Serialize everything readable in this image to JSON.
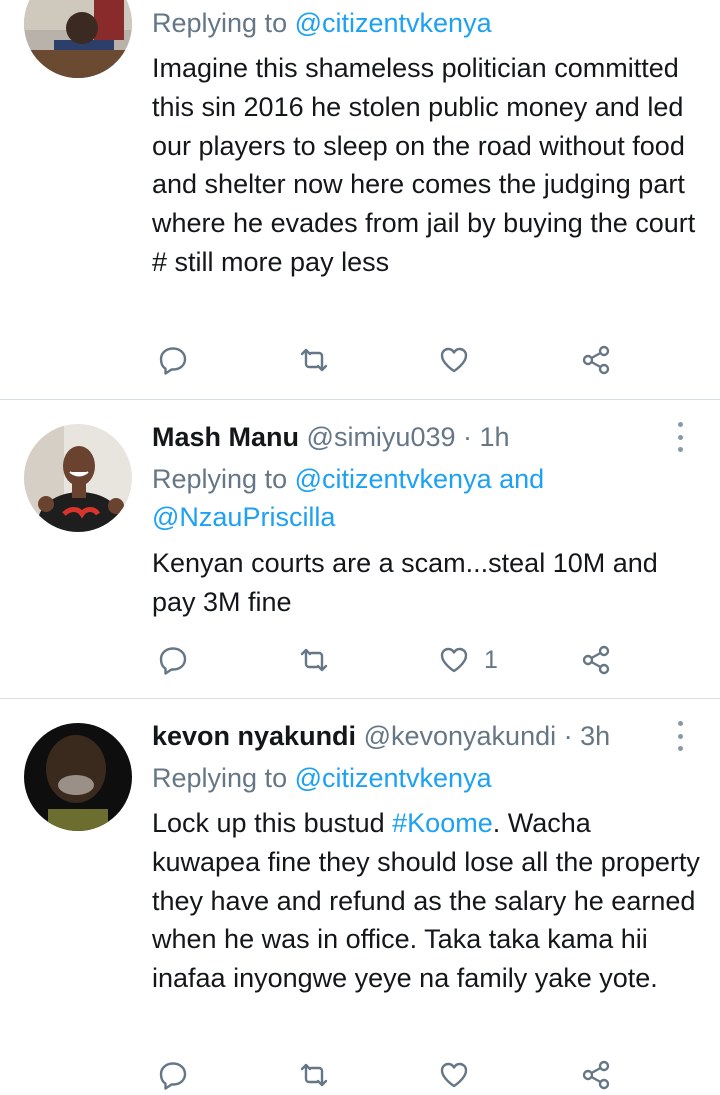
{
  "colors": {
    "link": "#1da1f2",
    "muted": "#657786",
    "text": "#14171a",
    "icon": "#657786"
  },
  "tweets": [
    {
      "name": "",
      "handle": "",
      "time": "",
      "reply_prefix": "Replying to ",
      "reply_mentions": [
        "@citizentvkenya"
      ],
      "body": "Imagine this shameless politician committed this sin 2016 he stolen public money and led our players to sleep on the road without food and shelter  now here comes the judging part where he evades from jail by buying the court # still more pay less",
      "likes": ""
    },
    {
      "name": "Mash Manu",
      "handle": "@simiyu039",
      "time": "· 1h",
      "reply_prefix": "Replying to ",
      "reply_mentions": [
        "@citizentvkenya",
        "@NzauPriscilla"
      ],
      "reply_joiner": " and ",
      "body": "Kenyan courts are a scam...steal 10M and pay 3M fine",
      "likes": "1"
    },
    {
      "name": "kevon nyakundi",
      "handle": "@kevonyakundi",
      "time": "· 3h",
      "reply_prefix": "Replying to ",
      "reply_mentions": [
        "@citizentvkenya"
      ],
      "body_before": "Lock up this bustud ",
      "hashtag": "#Koome",
      "body_after": ". Wacha kuwapea fine they should lose all the property they have and refund as the salary he earned when he was in office. Taka taka kama hii inafaa inyongwe yeye na family yake yote.",
      "likes": ""
    }
  ],
  "icons": [
    "reply-icon",
    "retweet-icon",
    "like-icon",
    "share-icon",
    "more-options-icon"
  ]
}
